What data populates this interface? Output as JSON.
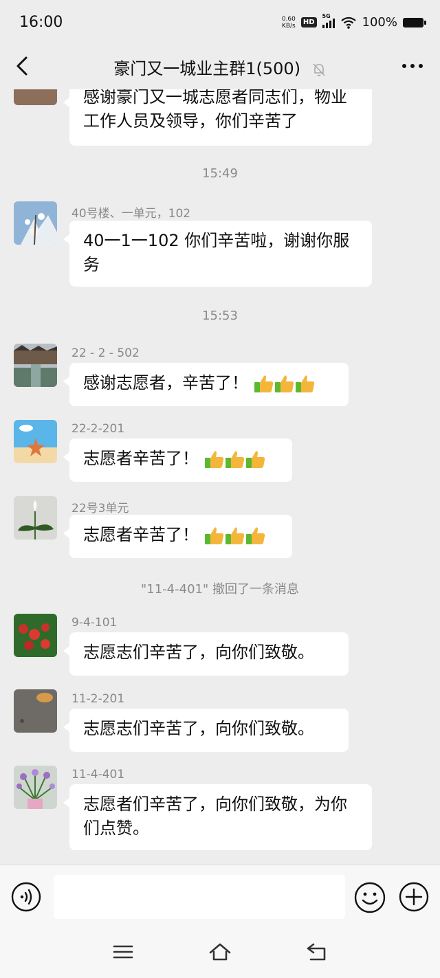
{
  "status_bar": {
    "time": "16:00",
    "net_speed_value": "0.60",
    "net_speed_unit": "KB/s",
    "hd": "HD",
    "network": "5G",
    "battery": "100%"
  },
  "header": {
    "title": "豪门又一城业主群1(500)",
    "back_icon": "chevron-left-icon",
    "mute_icon": "bell-off-icon",
    "more_icon": "more-icon"
  },
  "messages": [
    {
      "sender": "",
      "text": "感谢豪门又一城志愿者同志们，物业工作人员及领导，你们辛苦了"
    },
    {
      "time": "15:49"
    },
    {
      "sender": "40号楼、一单元，102",
      "text": "40一1一102 你们辛苦啦，谢谢你服务"
    },
    {
      "time": "15:53"
    },
    {
      "sender": "22 - 2 - 502",
      "text": "感谢志愿者，辛苦了！"
    },
    {
      "sender": "22-2-201",
      "text": "志愿者辛苦了！"
    },
    {
      "sender": "22号3单元",
      "text": "志愿者辛苦了！"
    },
    {
      "system": "\"11-4-401\" 撤回了一条消息"
    },
    {
      "sender": "9-4-101",
      "text": "志愿志们辛苦了，向你们致敬。"
    },
    {
      "sender": "11-2-201",
      "text": "志愿志们辛苦了，向你们致敬。"
    },
    {
      "sender": "11-4-401",
      "text": "志愿者们辛苦了，向你们致敬，为你们点赞。"
    }
  ],
  "input_bar": {
    "voice_icon": "voice-icon",
    "emoji_icon": "emoji-icon",
    "plus_icon": "plus-icon",
    "placeholder": ""
  },
  "nav_bar": {
    "icons": [
      "menu-icon",
      "home-icon",
      "back-icon"
    ]
  },
  "colors": {
    "background": "#ededed",
    "bubble": "#ffffff",
    "meta_text": "#888888",
    "thumb_yellow": "#f4b63a",
    "thumb_green": "#5cb82f"
  }
}
